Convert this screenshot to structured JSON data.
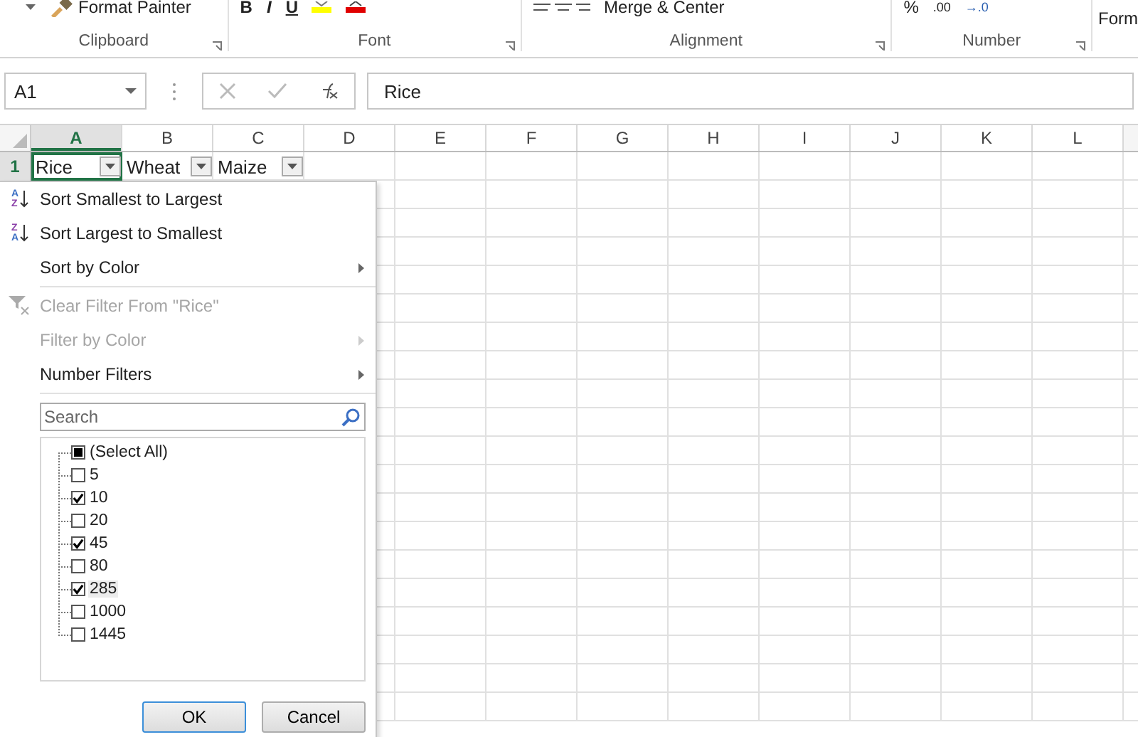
{
  "ribbon": {
    "clipboard_button": "Format Painter",
    "font_buttons": [
      "B",
      "I",
      "U"
    ],
    "merge_button": "Merge & Center",
    "format_button": "Form",
    "decimal_labels": [
      ".00",
      "→.0"
    ],
    "percent_label": "%",
    "groups": [
      {
        "label": "Clipboard"
      },
      {
        "label": "Font"
      },
      {
        "label": "Alignment"
      },
      {
        "label": "Number"
      }
    ]
  },
  "formula_bar": {
    "name_box": "A1",
    "value": "Rice"
  },
  "columns": [
    {
      "label": "A",
      "selected": true
    },
    {
      "label": "B",
      "selected": false
    },
    {
      "label": "C",
      "selected": false
    },
    {
      "label": "D",
      "selected": false
    },
    {
      "label": "E",
      "selected": false
    },
    {
      "label": "F",
      "selected": false
    },
    {
      "label": "G",
      "selected": false
    },
    {
      "label": "H",
      "selected": false
    },
    {
      "label": "I",
      "selected": false
    },
    {
      "label": "J",
      "selected": false
    },
    {
      "label": "K",
      "selected": false
    },
    {
      "label": "L",
      "selected": false
    }
  ],
  "rows": [
    {
      "label": "1",
      "cells": [
        "Rice",
        "Wheat",
        "Maize"
      ]
    }
  ],
  "filter_menu": {
    "sections": [
      [
        {
          "label": "Sort Smallest to Largest",
          "icon_text": [
            "A",
            "Z"
          ],
          "disabled": false,
          "submenu": false
        },
        {
          "label": "Sort Largest to Smallest",
          "icon_text": [
            "Z",
            "A"
          ],
          "disabled": false,
          "submenu": false
        },
        {
          "label": "Sort by Color",
          "disabled": false,
          "submenu": true
        }
      ],
      [
        {
          "label": "Clear Filter From \"Rice\"",
          "disabled": true,
          "submenu": false
        },
        {
          "label": "Filter by Color",
          "disabled": true,
          "submenu": true
        },
        {
          "label": "Number Filters",
          "disabled": false,
          "submenu": true
        }
      ]
    ],
    "search": {
      "placeholder": "Search"
    },
    "select_all": {
      "label": "(Select All)",
      "checked": false,
      "partial": true
    },
    "values": [
      {
        "label": "5",
        "checked": false,
        "selected": false
      },
      {
        "label": "10",
        "checked": true,
        "selected": false
      },
      {
        "label": "20",
        "checked": false,
        "selected": false
      },
      {
        "label": "45",
        "checked": true,
        "selected": false
      },
      {
        "label": "80",
        "checked": false,
        "selected": false
      },
      {
        "label": "285",
        "checked": true,
        "selected": true
      },
      {
        "label": "1000",
        "checked": false,
        "selected": false
      },
      {
        "label": "1445",
        "checked": false,
        "selected": false
      }
    ],
    "buttons": [
      {
        "label": "OK",
        "kind": "default"
      },
      {
        "label": "Cancel",
        "kind": "normal"
      }
    ]
  }
}
